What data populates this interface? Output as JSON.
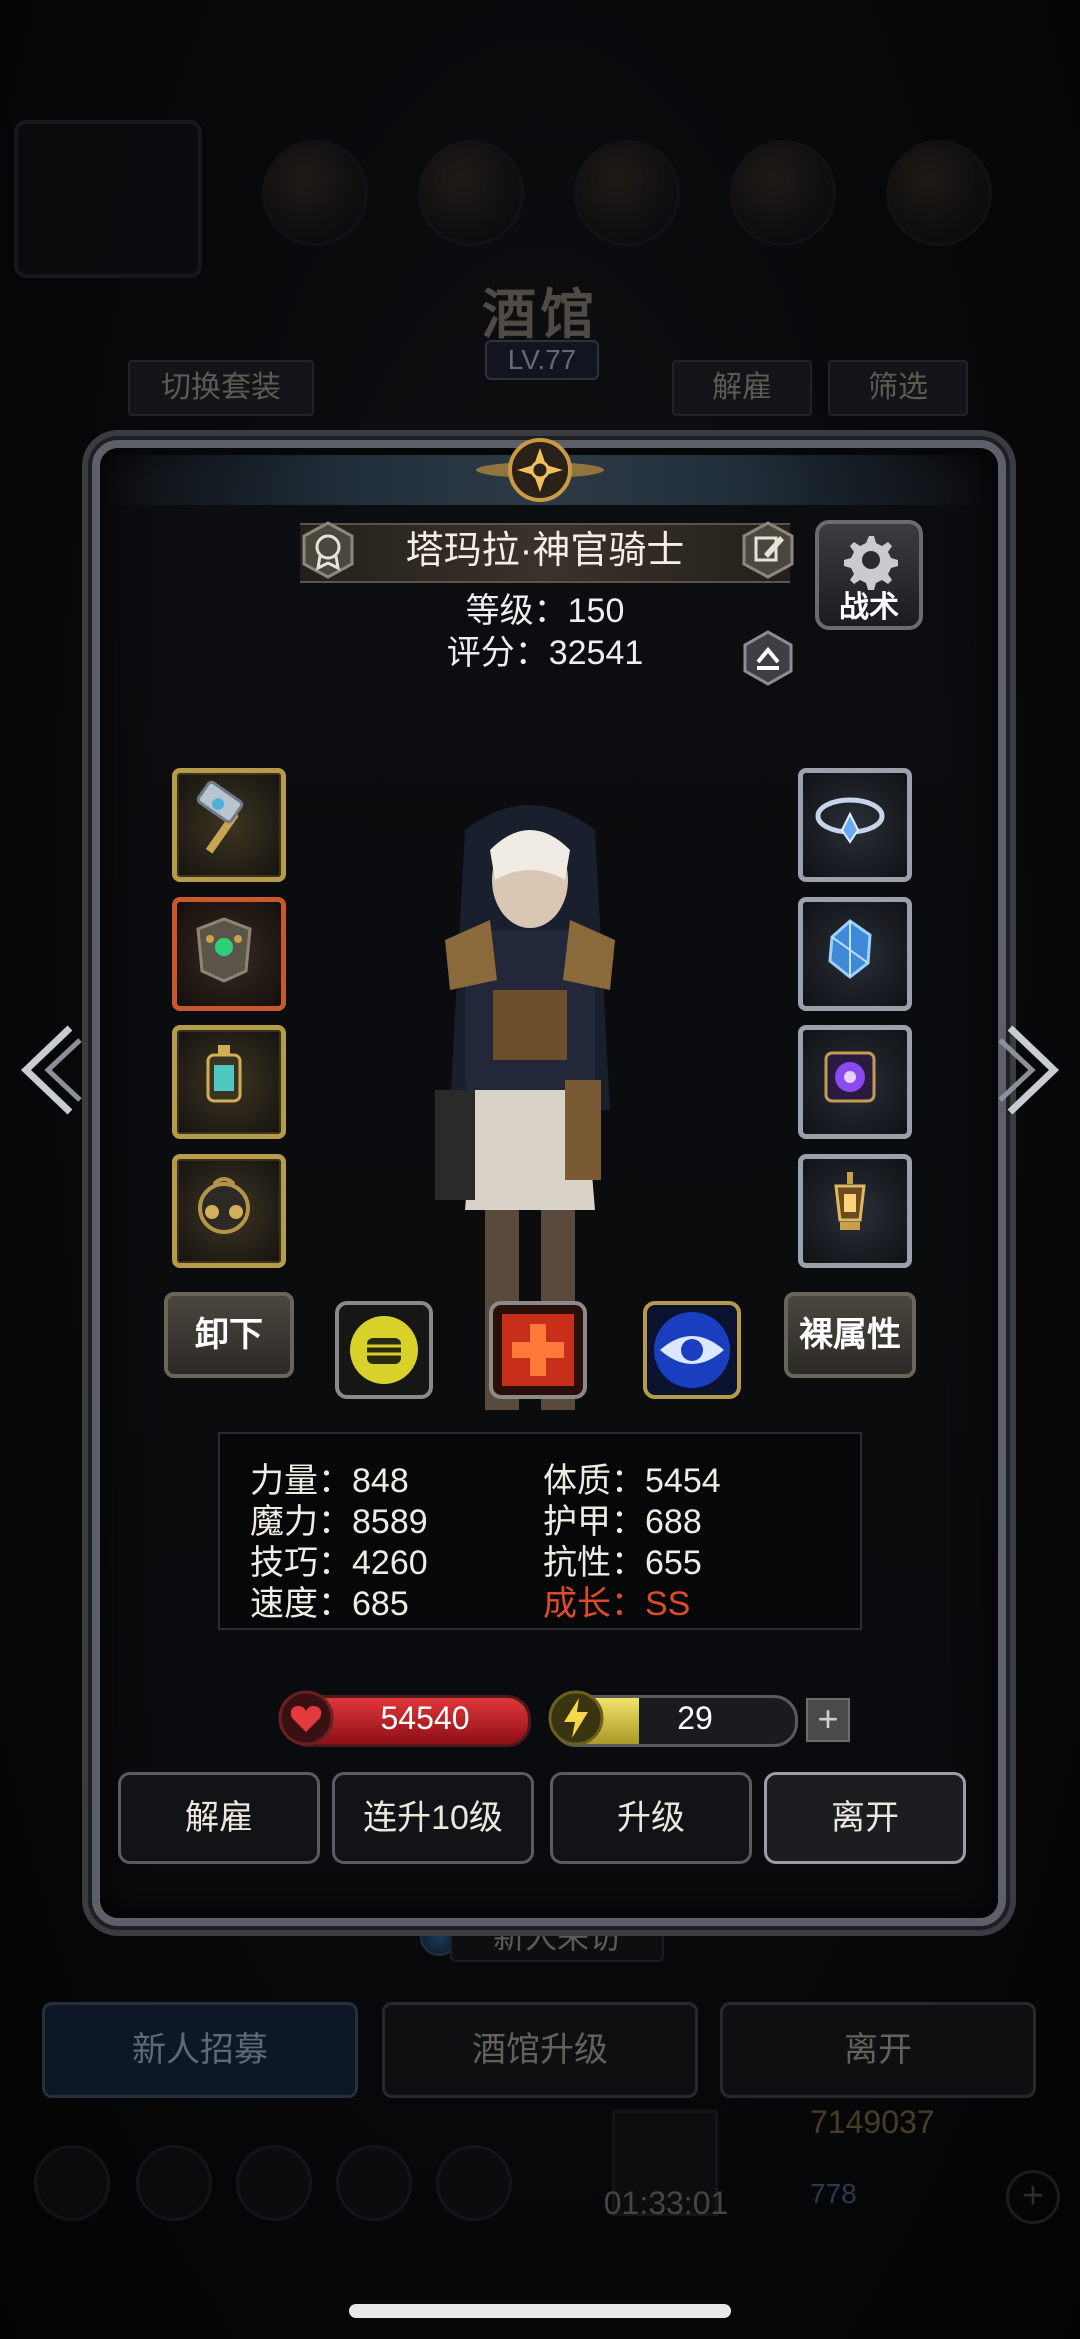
{
  "background": {
    "title": "酒馆",
    "level": "LV.77",
    "switch_outfit": "切换套装",
    "dismiss": "解雇",
    "filter": "筛选",
    "new_visitor": "新人来访",
    "bottom_buttons": [
      "新人招募",
      "酒馆升级",
      "离开"
    ],
    "timer": "01:33:01",
    "gold": "7149037",
    "gems": "778"
  },
  "hero": {
    "name": "塔玛拉·神官骑士",
    "level_label": "等级：",
    "level": "150",
    "score_label": "评分：",
    "score": "32541"
  },
  "tactics_label": "战术",
  "buttons": {
    "unequip": "卸下",
    "bare_attributes": "裸属性"
  },
  "equipment": {
    "left": [
      "hammer-icon",
      "emerald-armor-icon",
      "lantern-potion-icon",
      "bell-ring-icon"
    ],
    "right": [
      "storm-amulet-icon",
      "blue-crystal-icon",
      "purple-rune-icon",
      "golden-lantern-icon"
    ]
  },
  "skills": [
    "fist-icon",
    "red-cross-icon",
    "eye-icon"
  ],
  "stats": {
    "strength": "力量：848",
    "magic": "魔力：8589",
    "skill": "技巧：4260",
    "speed": "速度：685",
    "constitution": "体质：5454",
    "armor": "护甲：688",
    "resistance": "抗性：655",
    "growth": "成长：SS"
  },
  "hp": "54540",
  "energy": "29",
  "energy_fraction": 0.35,
  "energy_plus": "+",
  "actions": [
    "解雇",
    "连升10级",
    "升级",
    "离开"
  ],
  "colors": {
    "hp_red": "#e1363a",
    "energy_yellow": "#f2e36a",
    "growth_red": "#e04a2a",
    "gold_frame": "#b59b4a"
  }
}
